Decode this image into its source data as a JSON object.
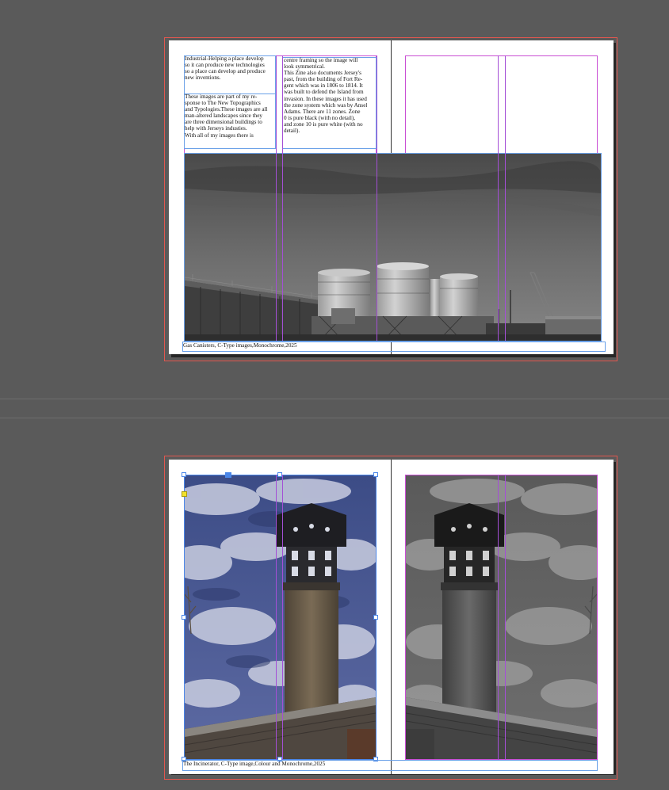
{
  "spread1": {
    "col1_text": "Industrial-Helping a place develop\nso it can produce new technologies\nso a place can develop and produce\nnew inventions.",
    "col1_text2": "These images are part of my re-\nsponse to The New Topographics\nand Typologies.These images  are all\nman-altered landscapes since they\nare three dimensional buildings to\nhelp with Jerseys industies.\nWith all of my images there is",
    "col2_text": "centre framing so the image will\nlook symmetrical.\nThis Zine also documents Jersey's\npast, from the building of Fort Re-\ngent which was in 1806 to 1814. It\nwas built to defend the Island from\ninvasion. In these images it has used\nthe zone system which was by Ansel\nAdams. There are 11 zones.  Zone\n0 is pure black (with no detail),\nand zone 10 is pure white (with no\ndetail).",
    "caption": "Gas Canisters, C-Type images,Monochrome,2025"
  },
  "spread2": {
    "caption": "The Incinerator, C-Type image,Colour and Monochrome,2025"
  },
  "colors": {
    "pasteboard": "#5a5a5a",
    "bleed": "#e2574f",
    "margin": "#c94fd4",
    "selection": "#4a86e8"
  }
}
